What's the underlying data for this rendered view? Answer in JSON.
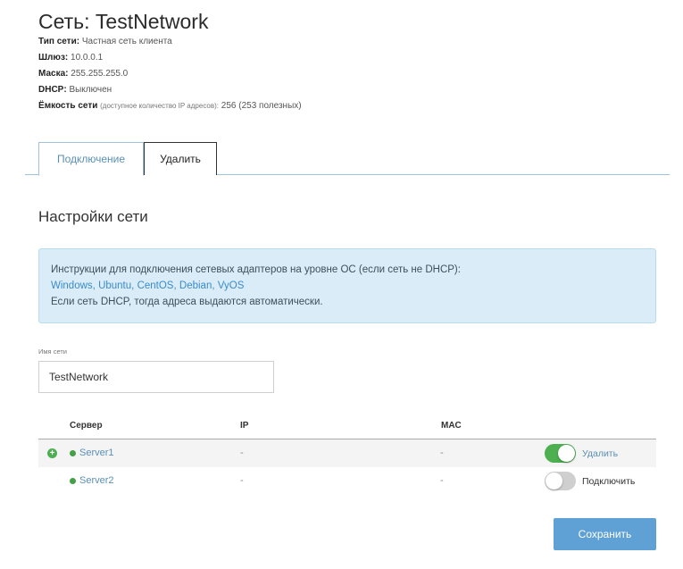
{
  "header": {
    "title": "Сеть: TestNetwork",
    "network_type_label": "Тип сети:",
    "network_type_value": "Частная сеть клиента",
    "gateway_label": "Шлюз:",
    "gateway_value": "10.0.0.1",
    "mask_label": "Маска:",
    "mask_value": "255.255.255.0",
    "dhcp_label": "DHCP:",
    "dhcp_value": "Выключен",
    "capacity_label": "Ёмкость сети",
    "capacity_note": "(доступное количество IP адресов):",
    "capacity_value": "256 (253 полезных)"
  },
  "tabs": [
    {
      "label": "Подключение",
      "active": true
    },
    {
      "label": "Удалить",
      "active": false
    }
  ],
  "section_title": "Настройки сети",
  "info": {
    "line1": "Инструкции для подключения сетевых адаптеров на уровне ОС (если сеть не DHCP):",
    "links": [
      "Windows",
      "Ubuntu",
      "CentOS",
      "Debian",
      "VyOS"
    ],
    "separator": ",",
    "line3": "Если сеть DHCP, тогда адреса выдаются автоматически."
  },
  "network_name_field": {
    "label": "Имя сети",
    "value": "TestNetwork"
  },
  "table": {
    "columns": [
      "Сервер",
      "IP",
      "MAC"
    ],
    "rows": [
      {
        "server": "Server1",
        "ip": "-",
        "mac": "-",
        "connected": true,
        "action": "Удалить"
      },
      {
        "server": "Server2",
        "ip": "-",
        "mac": "-",
        "connected": false,
        "action": "Подключить"
      }
    ]
  },
  "save_label": "Сохранить",
  "icons": {
    "expand": "plus-circle-icon",
    "status": "status-dot-icon"
  },
  "colors": {
    "accent": "#5fa1d4",
    "link": "#3a8ccc",
    "toggle_on": "#4caf50",
    "info_bg": "#d9ecf7"
  }
}
